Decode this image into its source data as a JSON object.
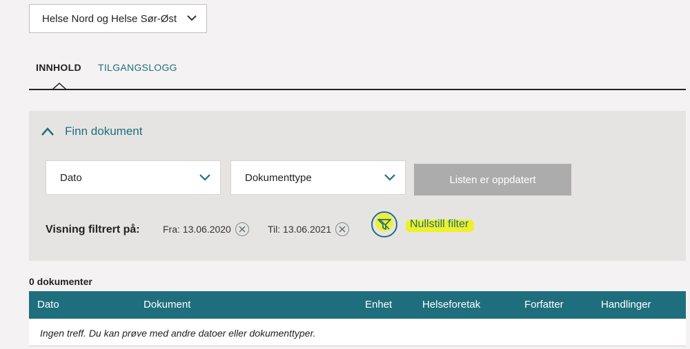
{
  "region_select": {
    "value": "Helse Nord og Helse Sør-Øst",
    "icon": "chevron-down-icon"
  },
  "tabs": [
    {
      "label": "INNHOLD",
      "active": true
    },
    {
      "label": "TILGANGSLOGG",
      "active": false
    }
  ],
  "finn": {
    "label": "Finn dokument",
    "expanded": true
  },
  "filters": {
    "date_dropdown": "Dato",
    "type_dropdown": "Dokumenttype",
    "refresh_button": "Listen er oppdatert",
    "filtered_label": "Visning filtrert på:",
    "from_chip": "Fra: 13.06.2020",
    "to_chip": "Til: 13.06.2021",
    "reset_label": "Nullstill filter"
  },
  "documents": {
    "count_label": "0 dokumenter",
    "columns": [
      "Dato",
      "Dokument",
      "Enhet",
      "Helseforetak",
      "Forfatter",
      "Handlinger"
    ],
    "empty_message": "Ingen treff. Du kan prøve med andre datoer eller dokumenttyper."
  },
  "colors": {
    "accent": "#1f6e7e",
    "panel": "#e6e4e2",
    "highlight": "#eef20c",
    "disabled_button": "#acacac"
  }
}
